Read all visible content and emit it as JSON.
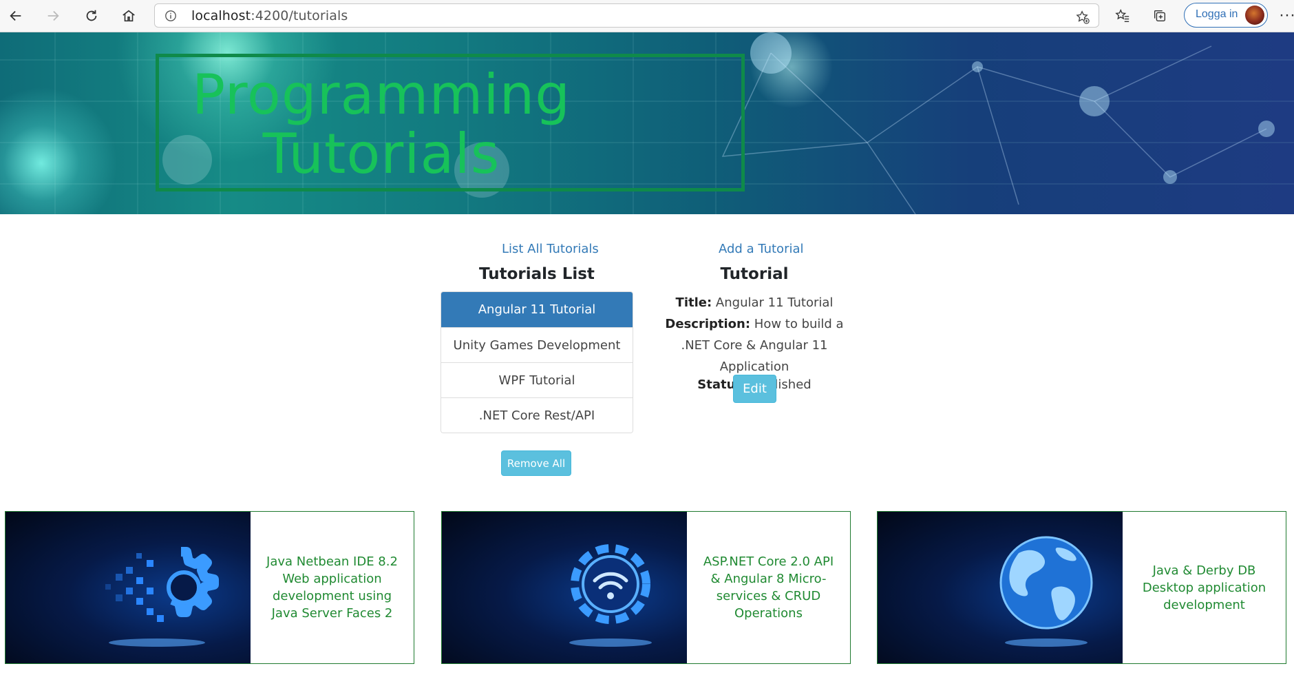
{
  "browser": {
    "url_host": "localhost",
    "url_path": ":4200/tutorials",
    "login_label": "Logga in",
    "more_label": "···"
  },
  "header": {
    "title_line1": "Programming",
    "title_line2": "Tutorials"
  },
  "nav": {
    "list_all": "List All Tutorials",
    "add": "Add a Tutorial"
  },
  "list": {
    "title": "Tutorials List",
    "items": [
      "Angular 11 Tutorial",
      "Unity Games Development",
      "WPF Tutorial",
      ".NET Core Rest/API"
    ],
    "active_index": 0,
    "remove_all_label": "Remove All"
  },
  "detail": {
    "heading": "Tutorial",
    "title_label": "Title:",
    "title_value": "Angular 11 Tutorial",
    "description_label": "Description:",
    "description_value": "How to build a .NET Core & Angular 11 Application",
    "status_label": "Status:",
    "status_value": "Published",
    "edit_label": "Edit"
  },
  "cards": [
    {
      "text": "Java Netbean IDE 8.2 Web application development using Java Server Faces 2",
      "icon": "gear-pixels-icon"
    },
    {
      "text": "ASP.NET Core 2.0 API & Angular 8 Micro-services & CRUD Operations",
      "icon": "gear-wifi-icon"
    },
    {
      "text": "Java & Derby DB Desktop application development",
      "icon": "globe-icon"
    }
  ],
  "colors": {
    "accent": "#337ab7",
    "info_button": "#5bc0de",
    "title_green": "#17c25a",
    "card_text_green": "#208a32"
  }
}
